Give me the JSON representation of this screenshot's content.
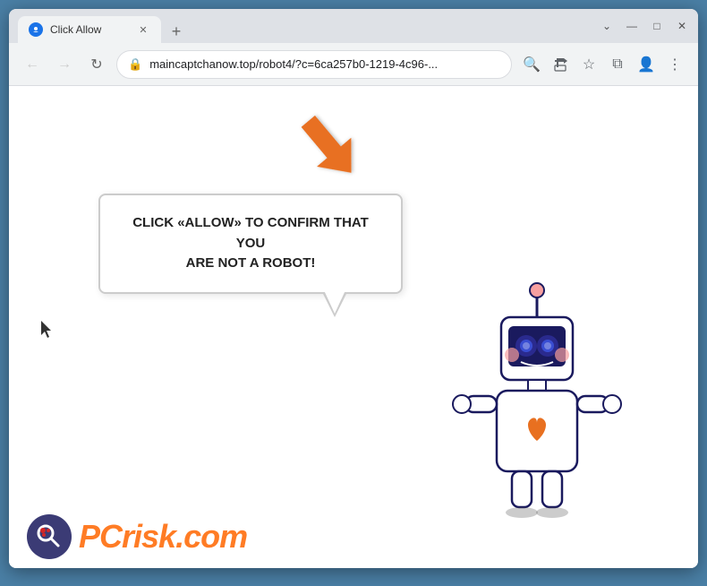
{
  "browser": {
    "tab": {
      "title": "Click Allow",
      "favicon_color": "#1a73e8"
    },
    "new_tab_icon": "+",
    "window_controls": {
      "chevron_down": "⌄",
      "minimize": "—",
      "maximize": "□",
      "close": "✕"
    },
    "toolbar": {
      "back_arrow": "←",
      "forward_arrow": "→",
      "refresh": "↻",
      "url": "maincaptchanow.top/robot4/?c=6ca257b0-1219-4c96-...",
      "search_icon": "🔍",
      "share_icon": "⎋",
      "bookmark_icon": "☆",
      "extensions_icon": "⧉",
      "profile_icon": "👤",
      "menu_icon": "⋮"
    }
  },
  "page": {
    "bubble_text_line1": "CLICK «ALLOW» TO CONFIRM THAT YOU",
    "bubble_text_line2": "ARE NOT A ROBOT!",
    "arrow_color": "#e87020",
    "background_color": "#ffffff"
  },
  "watermark": {
    "brand": "PC",
    "suffix": "risk.com",
    "suffix_color": "#ff6600"
  }
}
